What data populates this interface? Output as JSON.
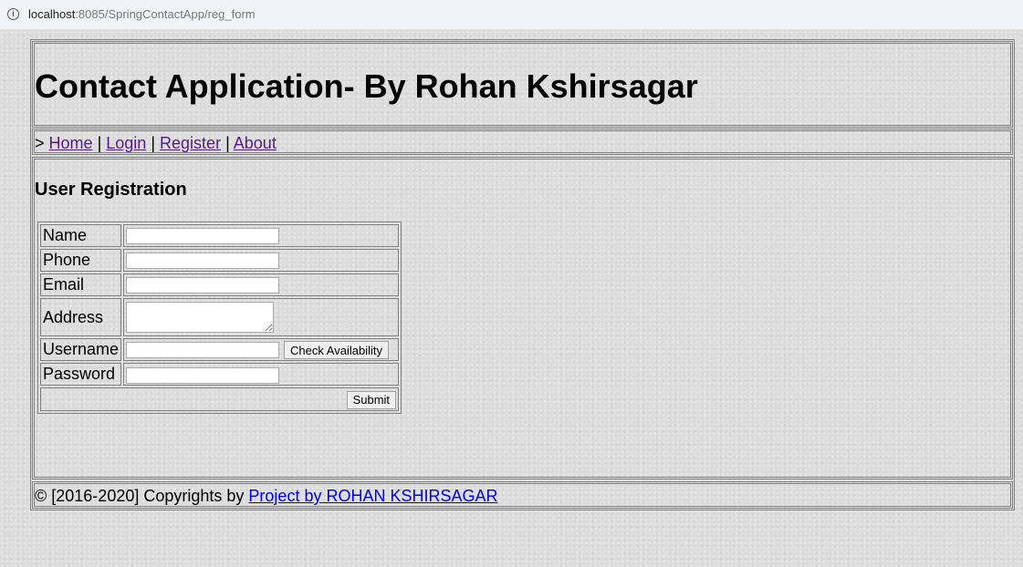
{
  "browser": {
    "info_glyph": "i",
    "url_host": "localhost",
    "url_path": ":8085/SpringContactApp/reg_form"
  },
  "header": {
    "title": "Contact Application- By Rohan Kshirsagar"
  },
  "nav": {
    "prefix": ">",
    "separator": "|",
    "links": [
      {
        "label": "Home"
      },
      {
        "label": "Login"
      },
      {
        "label": "Register"
      },
      {
        "label": "About"
      }
    ]
  },
  "form": {
    "heading": "User Registration",
    "fields": {
      "name": {
        "label": "Name",
        "value": ""
      },
      "phone": {
        "label": "Phone",
        "value": ""
      },
      "email": {
        "label": "Email",
        "value": ""
      },
      "address": {
        "label": "Address",
        "value": ""
      },
      "username": {
        "label": "Username",
        "value": ""
      },
      "password": {
        "label": "Password",
        "value": ""
      }
    },
    "check_availability_label": "Check Availability",
    "submit_label": "Submit"
  },
  "footer": {
    "text": "© [2016-2020] Copyrights by",
    "link_label": "Project by ROHAN KSHIRSAGAR"
  },
  "colors": {
    "visited_link": "#551a8b",
    "link": "#0000ee",
    "background": "#dcdcdc"
  }
}
